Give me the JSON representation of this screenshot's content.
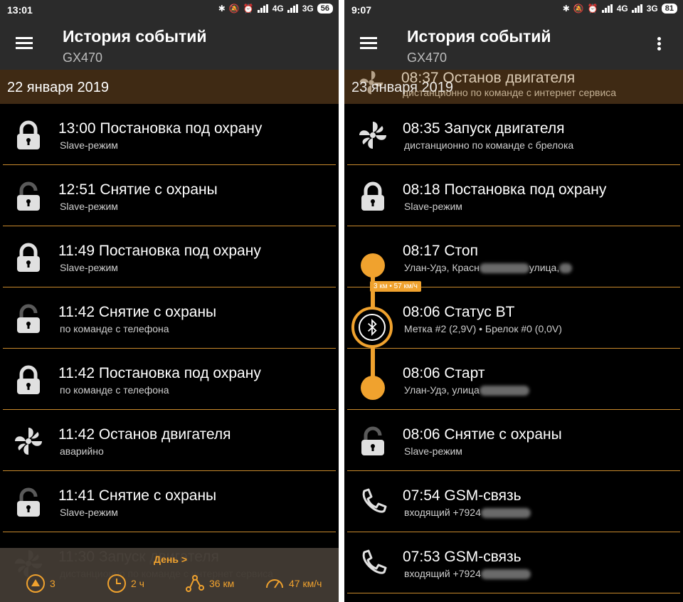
{
  "colors": {
    "accent": "#f0a22e",
    "divider": "#c98a2d",
    "date_bar": "#3f2a14",
    "appbar": "#2b2b2b"
  },
  "left": {
    "status": {
      "time": "13:01",
      "net1": "4G",
      "net2": "3G",
      "battery": "56"
    },
    "appbar": {
      "title": "История событий",
      "subtitle": "GX470"
    },
    "date": "22 января 2019",
    "events": [
      {
        "icon": "lock-closed-icon",
        "title": "13:00 Постановка под охрану",
        "sub": "Slave-режим"
      },
      {
        "icon": "lock-open-icon",
        "title": "12:51 Снятие с охраны",
        "sub": "Slave-режим"
      },
      {
        "icon": "lock-closed-icon",
        "title": "11:49 Постановка под охрану",
        "sub": "Slave-режим"
      },
      {
        "icon": "lock-open-icon",
        "title": "11:42 Снятие с охраны",
        "sub": "по команде с телефона"
      },
      {
        "icon": "lock-closed-icon",
        "title": "11:42 Постановка под охрану",
        "sub": "по команде с телефона"
      },
      {
        "icon": "fan-icon",
        "title": "11:42 Останов двигателя",
        "sub": "аварийно"
      },
      {
        "icon": "lock-open-icon",
        "title": "11:41 Снятие с охраны",
        "sub": "Slave-режим"
      },
      {
        "icon": "fan-icon",
        "title": "11:30 Запуск двигателя",
        "sub": "дистанционно по команде с интернет сервиса"
      }
    ],
    "footer": {
      "day_link": "День >",
      "stats": [
        {
          "icon": "alarm-icon",
          "value": "3"
        },
        {
          "icon": "clock-icon",
          "value": "2 ч"
        },
        {
          "icon": "route-icon",
          "value": "36 км"
        },
        {
          "icon": "speedometer-icon",
          "value": "47 км/ч"
        }
      ]
    }
  },
  "right": {
    "status": {
      "time": "9:07",
      "net1": "4G",
      "net2": "3G",
      "battery": "81"
    },
    "appbar": {
      "title": "История событий",
      "subtitle": "GX470"
    },
    "date": "23 января 2019",
    "header_event": {
      "title": "08:37 Останов двигателя",
      "sub": "дистанционно по команде с интернет сервиса"
    },
    "events": [
      {
        "icon": "fan-icon",
        "title": "08:35 Запуск двигателя",
        "sub": "дистанционно по команде с брелока"
      },
      {
        "icon": "lock-closed-icon",
        "title": "08:18 Постановка под охрану",
        "sub": "Slave-режим"
      },
      {
        "icon": "stop-dot-icon",
        "title": "08:17 Стоп",
        "sub": "Улан-Удэ, Красн",
        "sub2": "улица,"
      },
      {
        "icon": "bluetooth-icon",
        "title": "08:06 Статус BT",
        "sub": "Метка #2 (2,9V)  •  Брелок #0 (0,0V)"
      },
      {
        "icon": "start-dot-icon",
        "title": "08:06 Старт",
        "sub": "Улан-Удэ, улица"
      },
      {
        "icon": "lock-open-icon",
        "title": "08:06 Снятие с охраны",
        "sub": "Slave-режим"
      },
      {
        "icon": "phone-icon",
        "title": "07:54 GSM-связь",
        "sub": "входящий +7924"
      },
      {
        "icon": "phone-icon",
        "title": "07:53 GSM-связь",
        "sub": "входящий +7924"
      }
    ],
    "track_label": "3 км • 57 км/ч"
  }
}
